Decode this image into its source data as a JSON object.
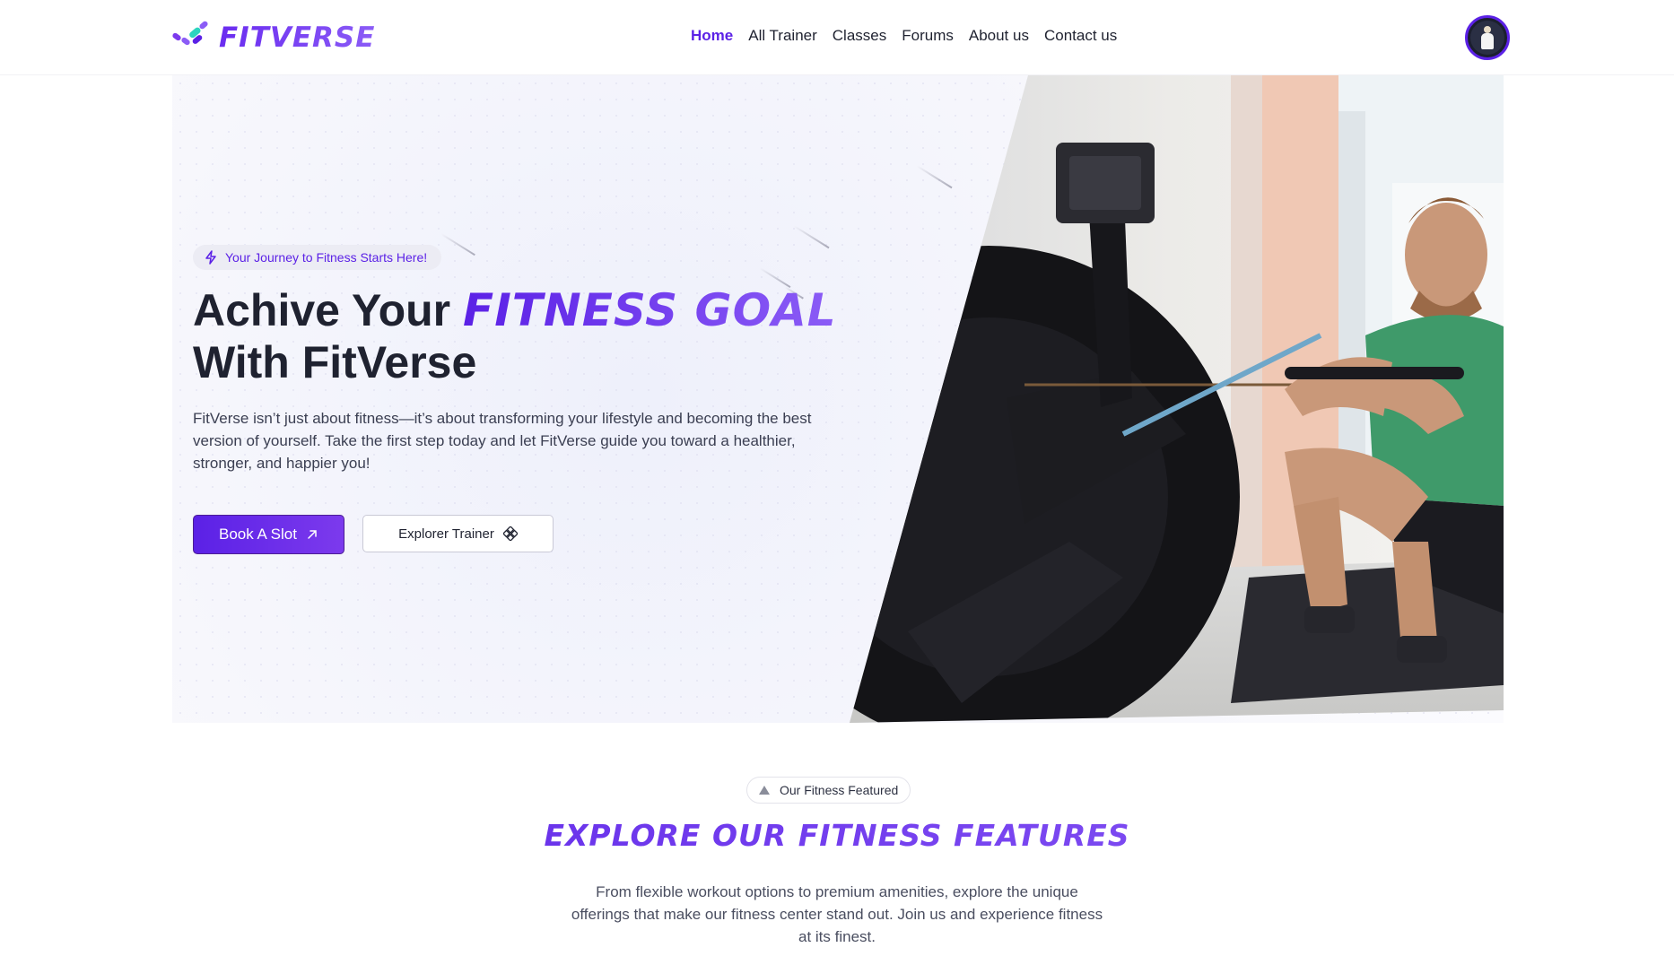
{
  "brand": {
    "name": "FITVERSE",
    "colors": {
      "accent": "#5b21e6",
      "accent_light": "#8b5cf6",
      "mark_teal": "#2dd4bf"
    }
  },
  "nav": {
    "items": [
      {
        "label": "Home",
        "active": true
      },
      {
        "label": "All Trainer",
        "active": false
      },
      {
        "label": "Classes",
        "active": false
      },
      {
        "label": "Forums",
        "active": false
      },
      {
        "label": "About us",
        "active": false
      },
      {
        "label": "Contact us",
        "active": false
      }
    ],
    "avatar_icon": "user-avatar"
  },
  "hero": {
    "badge": {
      "icon": "lightning-icon",
      "text": "Your Journey to Fitness Starts Here!"
    },
    "title_line1": "Achive Your",
    "title_accent": "FITNESS GOAL",
    "title_line2": "With FitVerse",
    "description": "FitVerse isn’t just about fitness—it’s about transforming your lifestyle and becoming the best version of yourself. Take the first step today and let FitVerse guide you toward a healthier, stronger, and happier you!",
    "primary_button": {
      "label": "Book A Slot",
      "icon": "arrow-up-right-icon"
    },
    "secondary_button": {
      "label": "Explorer Trainer",
      "icon": "diamond-grid-icon"
    },
    "image_subject": "man-on-rowing-machine"
  },
  "features": {
    "badge": {
      "icon": "triangle-icon",
      "text": "Our Fitness Featured"
    },
    "title": "EXPLORE OUR FITNESS FEATURES",
    "description": "From flexible workout options to premium amenities, explore the unique offerings that make our fitness center stand out. Join us and experience fitness at its finest."
  }
}
